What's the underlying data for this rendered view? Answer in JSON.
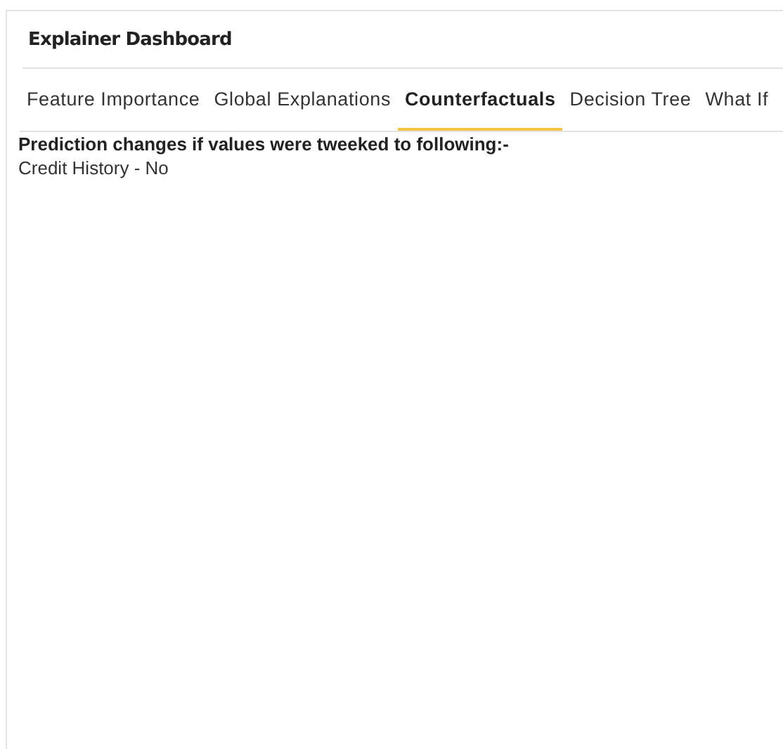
{
  "header": {
    "title": "Explainer Dashboard"
  },
  "tabs": [
    {
      "label": "Feature Importance",
      "selected": false
    },
    {
      "label": "Global Explanations",
      "selected": false
    },
    {
      "label": "Counterfactuals",
      "selected": true
    },
    {
      "label": "Decision Tree",
      "selected": false
    },
    {
      "label": "What If",
      "selected": false
    }
  ],
  "content": {
    "heading": "Prediction changes if values were tweeked to following:-",
    "lines": [
      "Credit History - No"
    ]
  }
}
